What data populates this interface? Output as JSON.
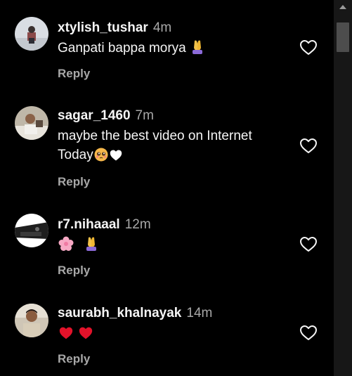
{
  "comments": [
    {
      "username": "xtylish_tushar",
      "time": "4m",
      "text": "Ganpati bappa morya",
      "emojis": [
        "folded-hands"
      ],
      "reply_label": "Reply"
    },
    {
      "username": "sagar_1460",
      "time": "7m",
      "text_line1": "maybe the best video on Internet",
      "text_line2": "Today",
      "emojis": [
        "pleading-face",
        "white-heart"
      ],
      "reply_label": "Reply"
    },
    {
      "username": "r7.nihaaal",
      "time": "12m",
      "text": "",
      "emojis": [
        "cherry-blossom",
        "folded-hands"
      ],
      "reply_label": "Reply"
    },
    {
      "username": "saurabh_khalnayak",
      "time": "14m",
      "text": "",
      "emojis": [
        "red-heart",
        "red-heart"
      ],
      "reply_label": "Reply"
    }
  ],
  "colors": {
    "background": "#000000",
    "primary_text": "#f5f5f5",
    "secondary_text": "#a8a8a8",
    "scrollbar_track": "#171717",
    "scrollbar_thumb": "#4d4d4d"
  },
  "icons": {
    "like": "heart-outline-icon",
    "scroll_up": "scroll-up-arrow-icon"
  }
}
